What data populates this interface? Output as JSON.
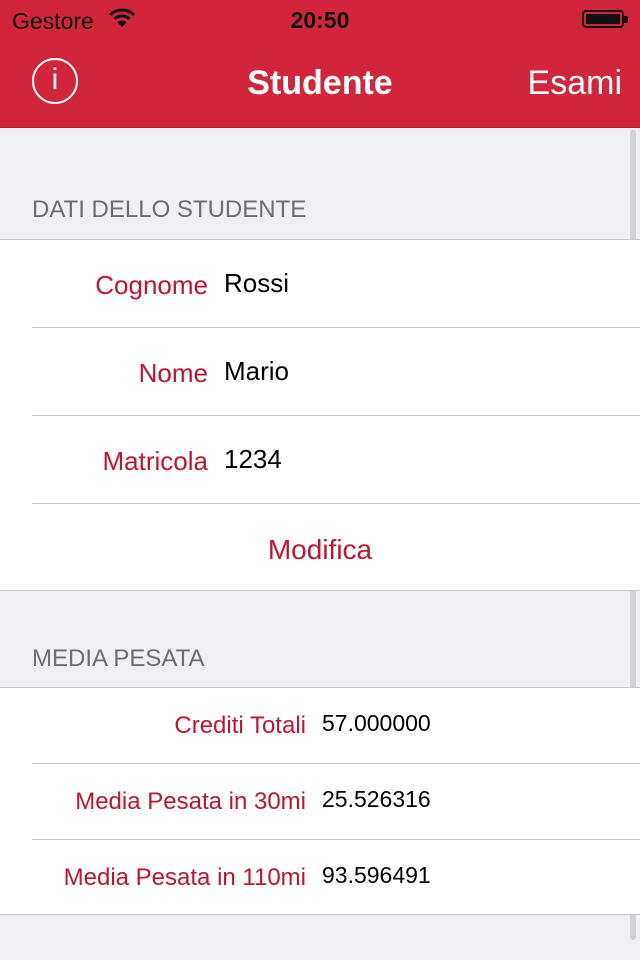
{
  "status_bar": {
    "carrier": "Gestore",
    "time": "20:50",
    "icons": [
      "wifi-icon",
      "battery-icon"
    ]
  },
  "nav": {
    "info_label": "i",
    "title": "Studente",
    "right_button": "Esami"
  },
  "student_section": {
    "header": "DATI DELLO STUDENTE",
    "rows": [
      {
        "label": "Cognome",
        "value": "Rossi"
      },
      {
        "label": "Nome",
        "value": "Mario"
      },
      {
        "label": "Matricola",
        "value": "1234"
      }
    ],
    "action": "Modifica"
  },
  "average_section": {
    "header": "MEDIA PESATA",
    "rows": [
      {
        "label": "Crediti Totali",
        "value": "57.000000"
      },
      {
        "label": "Media Pesata in 30mi",
        "value": "25.526316"
      },
      {
        "label": "Media Pesata in 110mi",
        "value": "93.596491"
      }
    ]
  },
  "colors": {
    "accent": "#d12539",
    "label": "#c0152f",
    "background": "#efeff4"
  }
}
